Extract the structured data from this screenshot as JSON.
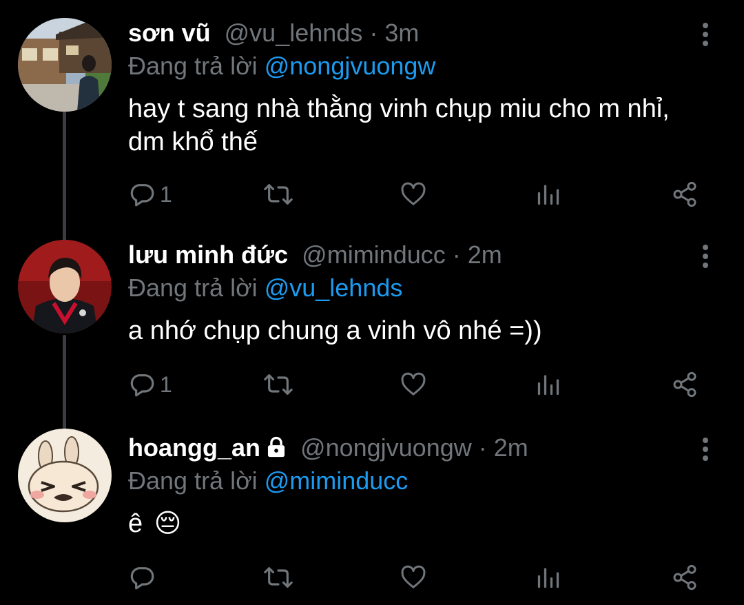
{
  "tweets": [
    {
      "display_name": "sơn vũ",
      "handle": "@vu_lehnds",
      "separator": "·",
      "time": "3m",
      "reply_prefix": "Đang trả lời",
      "reply_to": "@nongjvuongw",
      "text_line1": "hay t sang nhà thằng vinh chụp miu cho m nhỉ,",
      "text_line2": "dm khổ thế",
      "reply_count": "1",
      "locked": false
    },
    {
      "display_name": "lưu minh đức",
      "handle": "@miminducc",
      "separator": "·",
      "time": "2m",
      "reply_prefix": "Đang trả lời",
      "reply_to": "@vu_lehnds",
      "text_line1": "a nhớ chụp chung a vinh vô nhé =))",
      "reply_count": "1",
      "locked": false
    },
    {
      "display_name": "hoangg_an",
      "handle": "@nongjvuongw",
      "separator": "·",
      "time": "2m",
      "reply_prefix": "Đang trả lời",
      "reply_to": "@miminducc",
      "text_line1": "ê",
      "emoji": "😔",
      "reply_count": "",
      "locked": true
    }
  ],
  "icons": {
    "reply": "reply-icon",
    "retweet": "retweet-icon",
    "like": "heart-icon",
    "views": "analytics-icon",
    "share": "share-icon",
    "more": "more-vertical-icon",
    "lock": "lock-icon"
  },
  "colors": {
    "background": "#000000",
    "text": "#ffffff",
    "muted": "#71767b",
    "link": "#1d9bf0",
    "thread_line": "#3a3d41"
  }
}
